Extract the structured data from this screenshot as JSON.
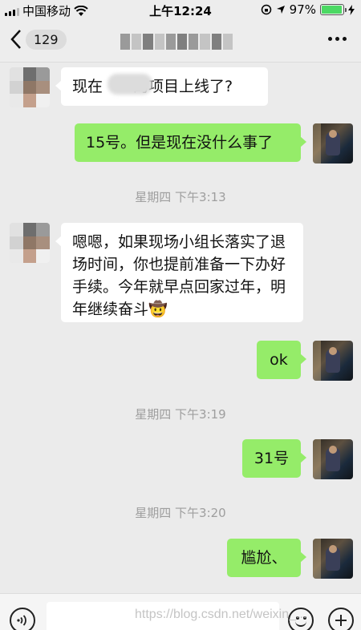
{
  "status_bar": {
    "carrier": "中国移动",
    "time": "上午12:24",
    "battery": "97%",
    "battery_level": 0.97,
    "colors": {
      "battery_fill": "#4cd964"
    }
  },
  "nav": {
    "unread_count": "129"
  },
  "messages": [
    {
      "side": "in",
      "text": "现在　　的项目上线了?"
    },
    {
      "side": "out",
      "text": "15号。但是现在没什么事了"
    },
    {
      "timestamp": "星期四 下午3:13"
    },
    {
      "side": "in",
      "text": "嗯嗯，如果现场小组长落实了退场时间，你也提前准备一下办好手续。今年就早点回家过年，明年继续奋斗🤠"
    },
    {
      "side": "out",
      "text": "ok"
    },
    {
      "timestamp": "星期四 下午3:19"
    },
    {
      "side": "out",
      "text": "31号"
    },
    {
      "timestamp": "星期四 下午3:20"
    },
    {
      "side": "out",
      "text": "尴尬、"
    }
  ],
  "input_bar": {
    "placeholder": ""
  },
  "watermark": "https://blog.csdn.net/weixin_...",
  "colors": {
    "chat_background": "#ebebeb",
    "incoming_bubble": "#ffffff",
    "outgoing_bubble": "#95ec69",
    "timestamp_text": "#9e9e9e"
  },
  "icons": [
    "wifi-icon",
    "location-icon",
    "lock-rotation-icon",
    "charging-icon",
    "back-chevron-icon",
    "more-icon",
    "voice-icon",
    "emoji-icon",
    "plus-icon"
  ]
}
